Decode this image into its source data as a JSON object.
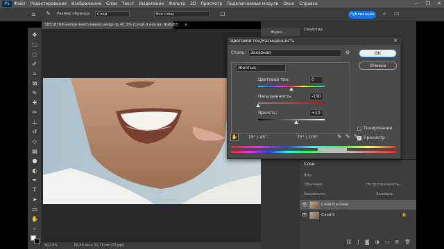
{
  "menubar": {
    "logo": "Ps",
    "items": [
      "Файл",
      "Редактирование",
      "Изображение",
      "Слои",
      "Текст",
      "Выделение",
      "Фильтр",
      "3D",
      "Просмотр",
      "Подключаемые модули",
      "Окно",
      "Справка"
    ],
    "controls": [
      "—",
      "❐",
      "✕"
    ]
  },
  "options": {
    "sample_size_label": "Размер образца:",
    "sample_size_value": "Слой",
    "sample_all_value": "Все слои",
    "publish_label": "Публикация"
  },
  "document": {
    "tab_title": "58518749-yellow-teeth-teaser.webp @ 40,3% (Слой 0 копия, RGB/8*)",
    "close": "×",
    "status_zoom": "40,13%",
    "status_size": "56,44 см x 31,75 см (72 ppi)"
  },
  "panels": {
    "journal": "Журн...",
    "properties": "Свойства",
    "layers_title": "Слои",
    "layers_search": "Вид",
    "blend_mode": "Обычные",
    "opacity_label": "Непрозрачность:",
    "fill_label": "Заливка:",
    "lock_label": "Закрепить:",
    "layers": [
      {
        "name": "Слой 0 копия",
        "selected": true,
        "locked": false
      },
      {
        "name": "Слой 0",
        "selected": false,
        "locked": true
      }
    ]
  },
  "dialog": {
    "title": "Цветовой тон/Насыщенность",
    "preset_label": "Стиль:",
    "preset_value": "Заказная",
    "ok": "ОК",
    "cancel": "Отмена",
    "channel": "Желтые",
    "hue_label": "Цветовой тон:",
    "hue_value": "0",
    "saturation_label": "Насыщенность:",
    "saturation_value": "-100",
    "lightness_label": "Яркость:",
    "lightness_value": "+10",
    "range_left": "15° / 45°",
    "range_right": "75° \\ 105°",
    "colorize_label": "Тонирование",
    "preview_label": "Просмотр",
    "preview_checked": true,
    "colorize_checked": false
  }
}
